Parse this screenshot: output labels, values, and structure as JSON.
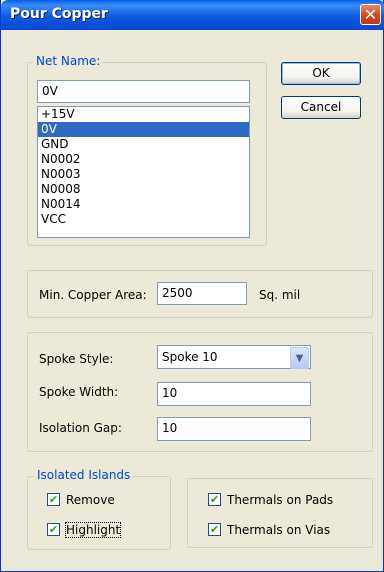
{
  "window": {
    "title": "Pour Copper",
    "close_glyph": "✕"
  },
  "net_name": {
    "group_label": "Net Name:",
    "value": "0V",
    "items": [
      "+15V",
      "0V",
      "GND",
      "N0002",
      "N0003",
      "N0008",
      "N0014",
      "VCC"
    ],
    "selected": "0V"
  },
  "buttons": {
    "ok": "OK",
    "cancel": "Cancel"
  },
  "copper_area": {
    "label": "Min. Copper Area:",
    "value": "2500",
    "unit": "Sq. mil"
  },
  "spoke": {
    "style_label": "Spoke Style:",
    "style_value": "Spoke 10",
    "width_label": "Spoke Width:",
    "width_value": "10",
    "gap_label": "Isolation Gap:",
    "gap_value": "10"
  },
  "isolated_islands": {
    "group_label": "Isolated Islands",
    "remove_label": "Remove",
    "remove_checked": true,
    "highlight_label": "Highlight",
    "highlight_checked": true
  },
  "thermals": {
    "pads_label": "Thermals on Pads",
    "pads_checked": true,
    "vias_label": "Thermals on Vias",
    "vias_checked": true
  },
  "colors": {
    "titlebar": "#0A5FE8",
    "dialog_bg": "#ECE9D8",
    "selection": "#316AC5",
    "group_legend": "#0046D5"
  }
}
